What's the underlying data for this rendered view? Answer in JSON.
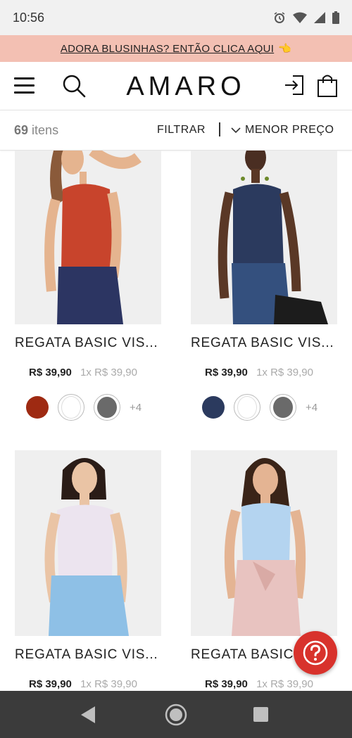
{
  "status_bar": {
    "time": "10:56",
    "icons": [
      "alarm-icon",
      "wifi-icon",
      "signal-icon",
      "battery-icon"
    ]
  },
  "promo": {
    "text": "ADORA BLUSINHAS? ENTÃO CLICA AQUI",
    "emoji": "👈",
    "bg_color": "#f3c0b3"
  },
  "header": {
    "logo": "AMARO",
    "icons": [
      "menu-icon",
      "search-icon",
      "login-icon",
      "shopping-bag-icon"
    ]
  },
  "toolbar": {
    "count_number": "69",
    "count_label": "itens",
    "filter_label": "FILTRAR",
    "separator": "|",
    "sort_label": "MENOR PREÇO"
  },
  "products": [
    {
      "name": "REGATA BASIC VIS...",
      "price": "R$ 39,90",
      "installment": "1x R$ 39,90",
      "colors": [
        "#9e2a12",
        "#ffffff",
        "#6a6a6a"
      ],
      "more_colors": "+4",
      "image": "woman-red-tank-top"
    },
    {
      "name": "REGATA BASIC VIS...",
      "price": "R$ 39,90",
      "installment": "1x R$ 39,90",
      "colors": [
        "#2b3a5e",
        "#ffffff",
        "#6a6a6a"
      ],
      "more_colors": "+4",
      "image": "woman-navy-tank-top"
    },
    {
      "name": "REGATA BASIC VIS...",
      "price": "R$ 39,90",
      "installment": "1x R$ 39,90",
      "image": "woman-white-tank-top"
    },
    {
      "name": "REGATA BASIC VIS...",
      "price": "R$ 39,90",
      "installment": "1x R$ 39,90",
      "image": "woman-light-blue-tank-top"
    }
  ],
  "help_button": {
    "icon": "question-icon",
    "color": "#d8322c"
  },
  "nav_bar": {
    "icons": [
      "back-icon",
      "home-icon",
      "recents-icon"
    ]
  }
}
